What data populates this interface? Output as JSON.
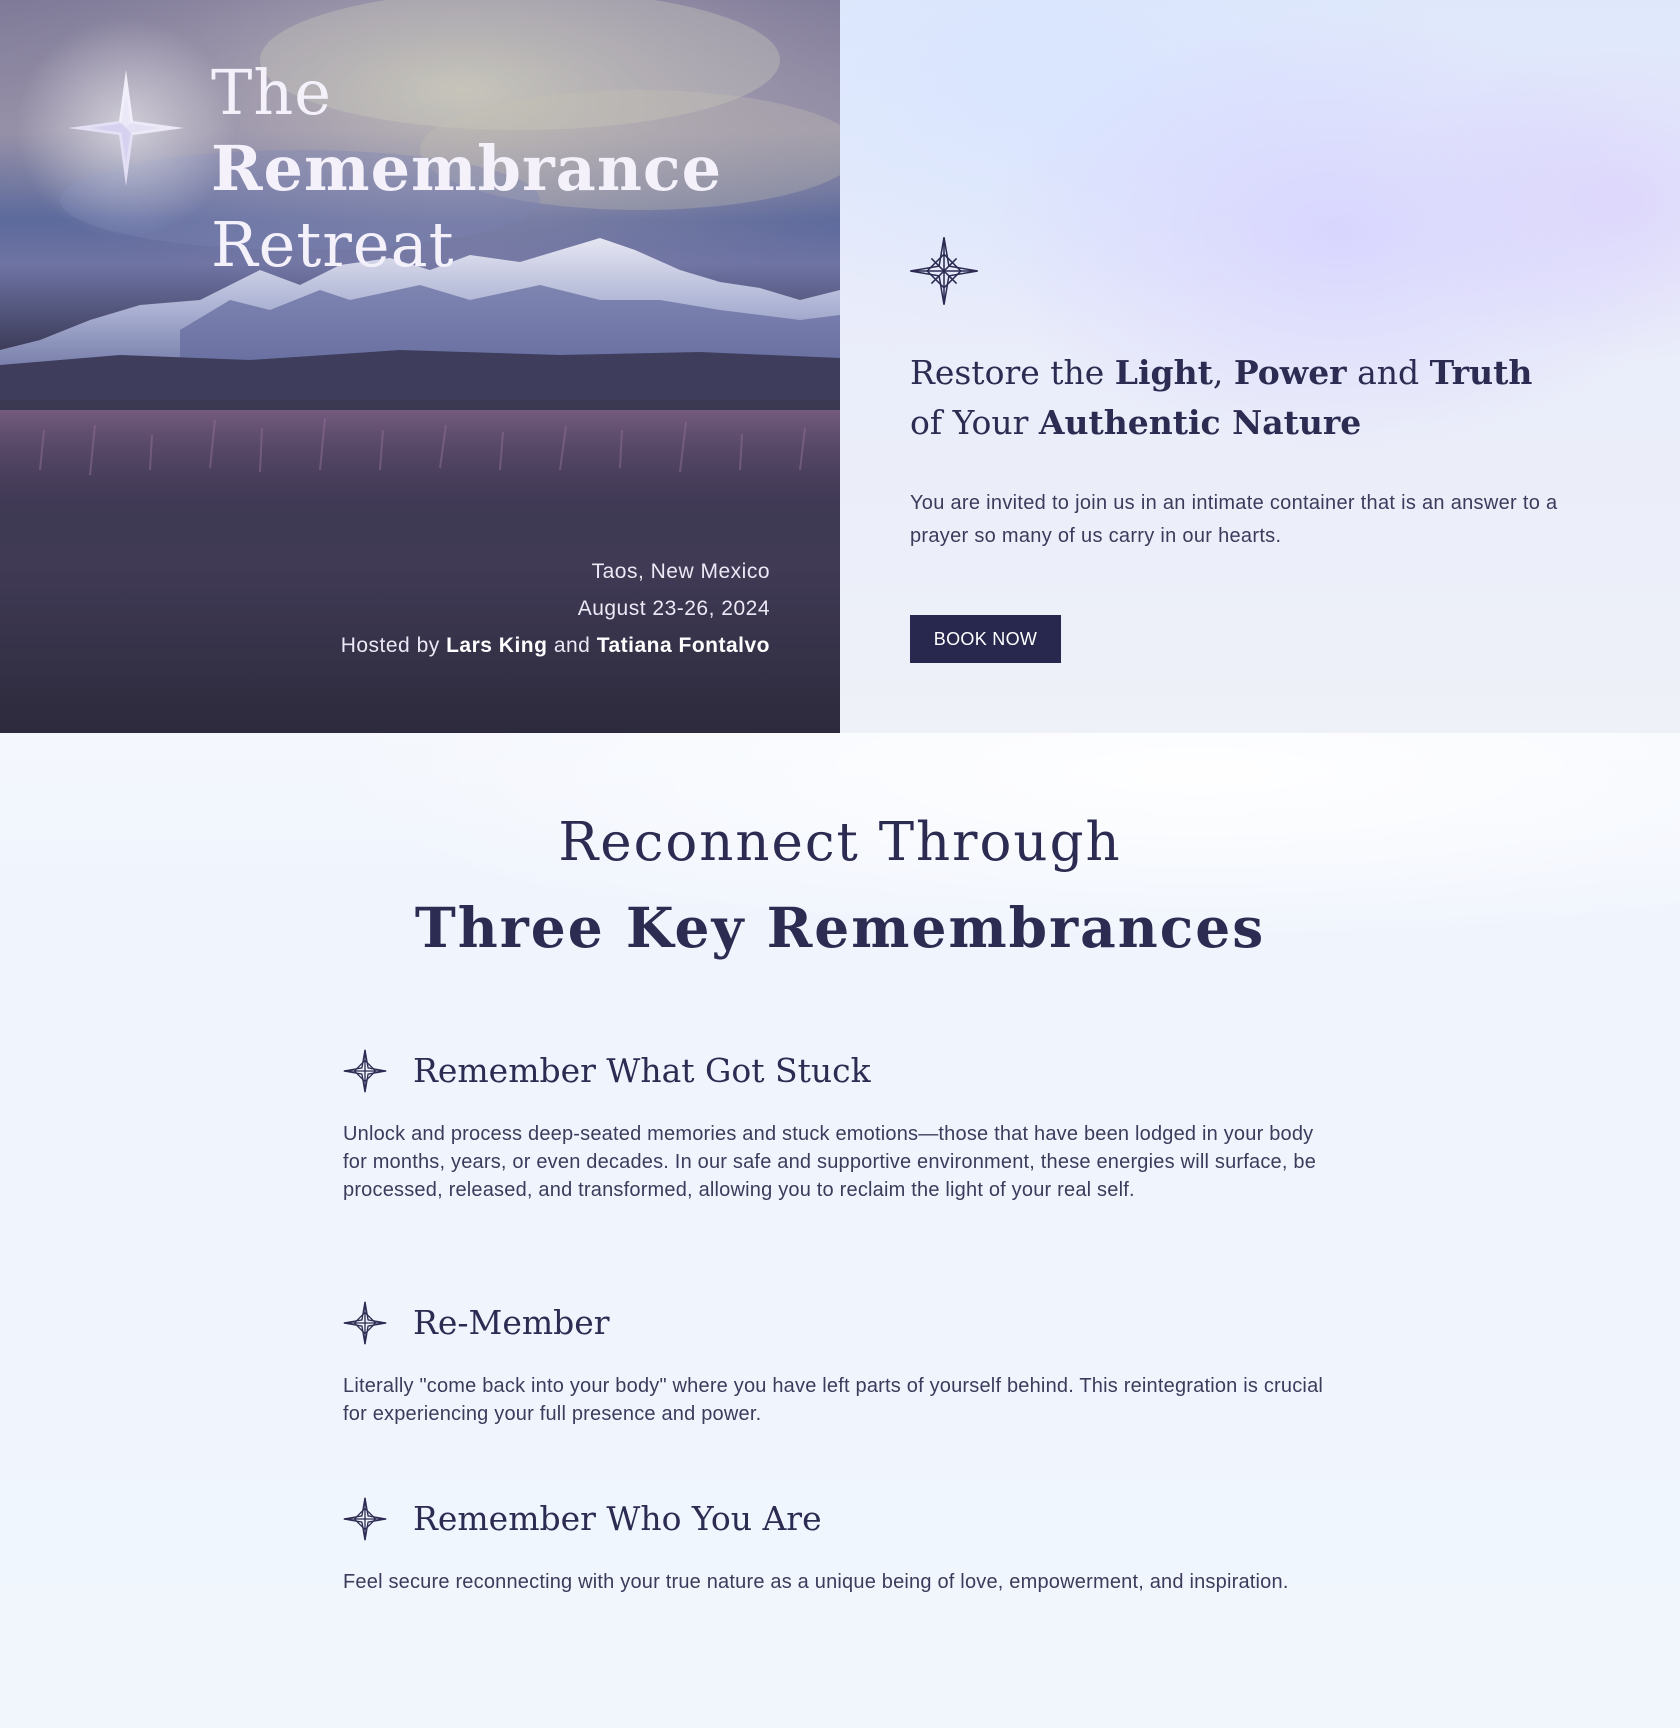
{
  "hero": {
    "title_word_1": "The",
    "title_word_2": "Remembrance",
    "title_word_3": "Retreat",
    "location": "Taos, New Mexico",
    "dates": "August 23-26, 2024",
    "hosted_by_prefix": "Hosted by",
    "host_1": "Lars King",
    "and_text": "and",
    "host_2": "Tatiana Fontalvo",
    "star_icon": "north-star-icon"
  },
  "intro": {
    "star_icon": "compass-star-icon",
    "headline": {
      "part_1": "Restore the",
      "light": "Light",
      "comma": ",",
      "power": "Power",
      "and": "and",
      "truth": "Truth",
      "part_2": "of Your",
      "authentic_nature": "Authentic Nature"
    },
    "paragraph": "You are invited to join us in an intimate container that is an answer to a prayer so many of us carry in our hearts.",
    "book_button": "BOOK NOW"
  },
  "remembrances": {
    "heading_line_1": "Reconnect Through",
    "heading_line_2": "Three Key Remembrances",
    "items": [
      {
        "icon": "compass-star-icon",
        "title": "Remember What Got Stuck",
        "body": "Unlock and process deep-seated memories and stuck emotions—those that have been lodged in your body for months, years, or even decades. In our safe and supportive environment, these energies will surface, be processed, released, and transformed, allowing you to reclaim the light of your real self."
      },
      {
        "icon": "compass-star-icon",
        "title": "Re-Member",
        "body": "Literally \"come back into your body\" where you have left parts of yourself behind. This reintegration is crucial for experiencing your full presence and power."
      },
      {
        "icon": "compass-star-icon",
        "title": "Remember Who You Are",
        "body": "Feel secure reconnecting with your true nature as a unique being of love, empowerment, and inspiration."
      }
    ]
  },
  "colors": {
    "navy": "#28284e",
    "text": "#2c2b52",
    "body_text": "#3c3b5c",
    "hero_text": "#f4f1fb",
    "page_bg": "#f1f6fd"
  }
}
